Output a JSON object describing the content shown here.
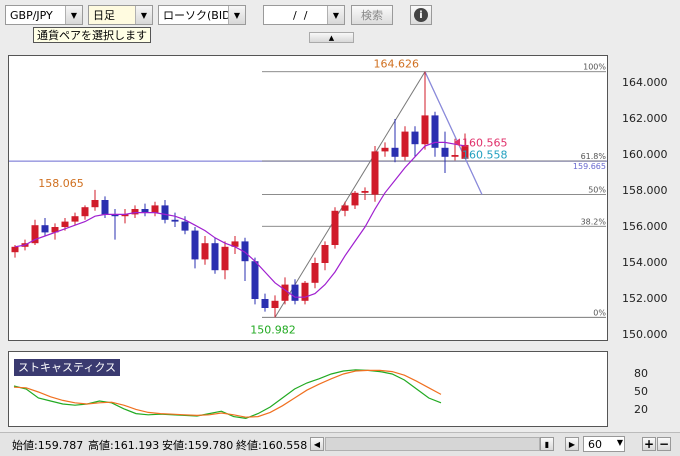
{
  "toolbar": {
    "pair": "GBP/JPY",
    "timeframe": "日足",
    "chart_type": "ローソク(BID)",
    "date": "  /  /",
    "search_label": "検索",
    "info_icon": "info-icon"
  },
  "tooltip": "通貨ペアを選択します",
  "colors": {
    "up": "#d01b2a",
    "down": "#2a2fb0",
    "ma": "#a020d0",
    "fib": "#666666",
    "k": "#22aa22",
    "d": "#f07020"
  },
  "chart_data": [
    {
      "type": "candlestick",
      "ylim": [
        150.0,
        165.0
      ],
      "yticks": [
        "164.000",
        "162.000",
        "160.000",
        "158.000",
        "156.000",
        "154.000",
        "152.000",
        "150.000"
      ],
      "candles": [
        [
          154.6,
          155.0,
          154.3,
          154.9
        ],
        [
          154.9,
          155.3,
          154.7,
          155.1
        ],
        [
          155.1,
          156.4,
          155.0,
          156.1
        ],
        [
          156.1,
          156.5,
          155.5,
          155.7
        ],
        [
          155.7,
          156.2,
          155.3,
          156.0
        ],
        [
          156.0,
          156.5,
          155.8,
          156.3
        ],
        [
          156.3,
          156.8,
          156.1,
          156.6
        ],
        [
          156.6,
          157.2,
          156.4,
          157.1
        ],
        [
          157.1,
          158.065,
          156.9,
          157.5
        ],
        [
          157.5,
          157.7,
          156.5,
          156.7
        ],
        [
          156.7,
          157.0,
          155.3,
          156.6
        ],
        [
          156.6,
          157.0,
          156.2,
          156.7
        ],
        [
          156.7,
          157.2,
          156.5,
          157.0
        ],
        [
          157.0,
          157.3,
          156.6,
          156.8
        ],
        [
          156.8,
          157.4,
          156.6,
          157.2
        ],
        [
          157.2,
          157.5,
          156.2,
          156.4
        ],
        [
          156.4,
          156.8,
          156.0,
          156.3
        ],
        [
          156.3,
          156.6,
          155.6,
          155.8
        ],
        [
          155.8,
          156.0,
          153.7,
          154.2
        ],
        [
          154.2,
          155.5,
          153.9,
          155.1
        ],
        [
          155.1,
          155.4,
          153.4,
          153.6
        ],
        [
          153.6,
          155.2,
          153.1,
          154.9
        ],
        [
          154.9,
          155.5,
          154.5,
          155.2
        ],
        [
          155.2,
          155.4,
          153.0,
          154.1
        ],
        [
          154.1,
          154.3,
          151.7,
          152.0
        ],
        [
          152.0,
          152.3,
          151.3,
          151.5
        ],
        [
          151.5,
          152.2,
          150.982,
          151.9
        ],
        [
          151.9,
          153.2,
          151.7,
          152.8
        ],
        [
          152.8,
          153.1,
          151.7,
          151.9
        ],
        [
          151.9,
          153.0,
          151.7,
          152.9
        ],
        [
          152.9,
          154.3,
          152.6,
          154.0
        ],
        [
          154.0,
          155.2,
          153.6,
          155.0
        ],
        [
          155.0,
          157.1,
          154.8,
          156.9
        ],
        [
          156.9,
          157.4,
          156.6,
          157.2
        ],
        [
          157.2,
          158.0,
          157.0,
          157.9
        ],
        [
          157.9,
          158.2,
          157.5,
          158.0
        ],
        [
          157.8,
          160.5,
          157.4,
          160.2
        ],
        [
          160.2,
          160.7,
          159.9,
          160.4
        ],
        [
          160.4,
          162.0,
          159.6,
          159.9
        ],
        [
          159.9,
          161.6,
          159.7,
          161.3
        ],
        [
          161.3,
          161.6,
          159.9,
          160.6
        ],
        [
          160.6,
          164.626,
          160.3,
          162.2
        ],
        [
          162.2,
          162.4,
          159.9,
          160.4
        ],
        [
          160.4,
          161.3,
          159.0,
          159.9
        ],
        [
          159.9,
          160.9,
          159.7,
          160.0
        ],
        [
          159.787,
          161.193,
          159.78,
          160.558
        ]
      ],
      "ma": [
        154.9,
        155.0,
        155.3,
        155.5,
        155.7,
        155.9,
        156.1,
        156.3,
        156.6,
        156.7,
        156.7,
        156.7,
        156.8,
        156.8,
        156.8,
        156.7,
        156.6,
        156.4,
        156.1,
        155.8,
        155.4,
        155.1,
        154.9,
        154.6,
        154.1,
        153.5,
        152.9,
        152.5,
        152.1,
        152.1,
        152.3,
        152.8,
        153.5,
        154.4,
        155.2,
        156.0,
        157.0,
        157.9,
        158.6,
        159.3,
        159.9,
        160.5,
        160.7,
        160.7,
        160.6,
        160.5
      ],
      "labels": {
        "high": "164.626",
        "low": "150.982",
        "left_high": "158.065",
        "bid": "160.565",
        "ask": "160.558",
        "fib_level": "159.665"
      },
      "fib": [
        "100%",
        "61.8%",
        "50%",
        "38.2%",
        "0%"
      ],
      "fib_values": [
        164.626,
        159.665,
        157.804,
        156.04,
        150.982
      ],
      "horizontal_line": 159.66
    },
    {
      "type": "line",
      "title": "ストキャスティクス",
      "ylim": [
        0,
        100
      ],
      "yticks": [
        "80",
        "50",
        "20"
      ],
      "series": [
        {
          "values": [
            60,
            55,
            40,
            35,
            30,
            28,
            30,
            35,
            32,
            22,
            14,
            12,
            13,
            12,
            11,
            10,
            14,
            18,
            9,
            6,
            14,
            25,
            40,
            55,
            65,
            72,
            80,
            85,
            87,
            86,
            84,
            80,
            70,
            55,
            40,
            32
          ]
        },
        {
          "values": [
            58,
            57,
            50,
            42,
            36,
            32,
            30,
            32,
            33,
            28,
            21,
            16,
            14,
            13,
            12,
            11,
            12,
            15,
            12,
            8,
            9,
            16,
            27,
            40,
            53,
            63,
            72,
            80,
            85,
            86,
            86,
            84,
            78,
            68,
            57,
            46
          ]
        }
      ]
    }
  ],
  "status": {
    "open": "始値:159.787",
    "high": "高値:161.193",
    "low": "安値:159.780",
    "close": "終値:160.558",
    "count": "60"
  }
}
